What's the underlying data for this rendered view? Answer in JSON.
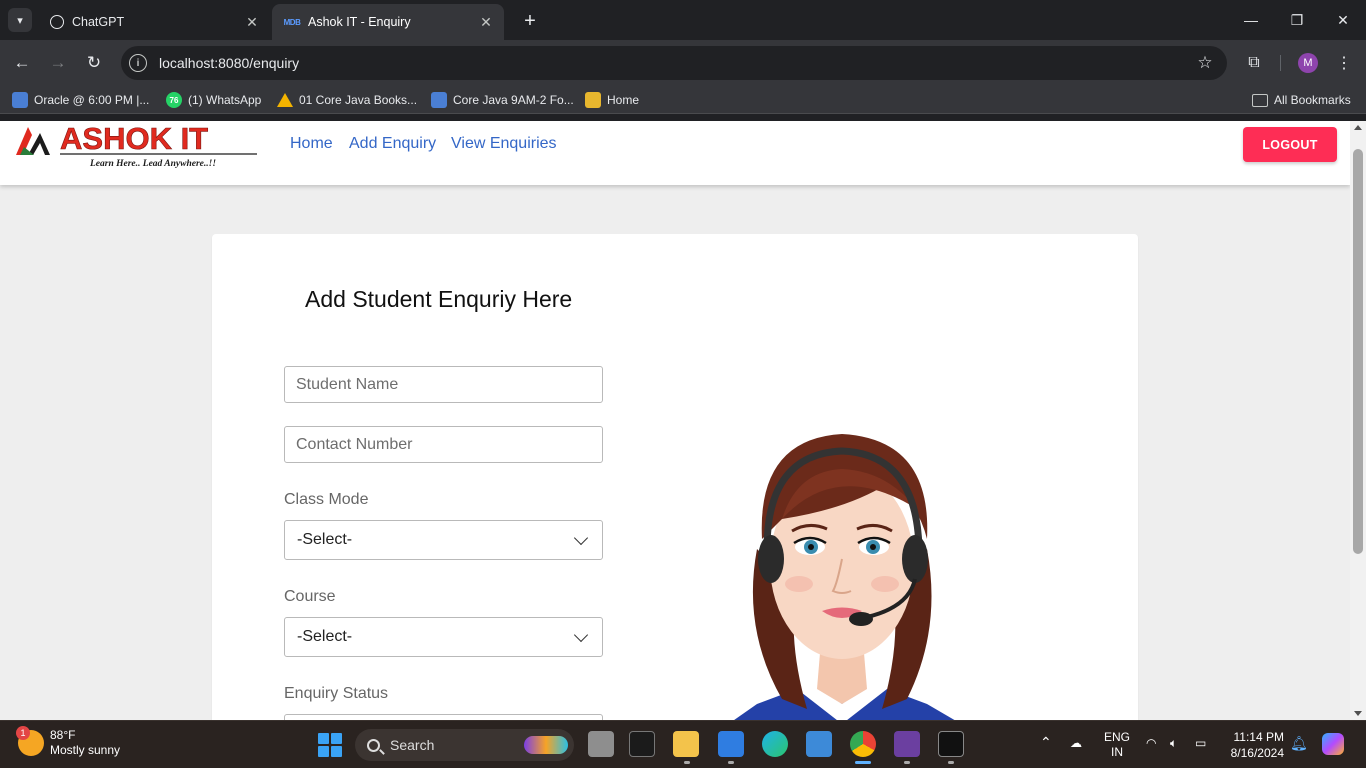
{
  "browser": {
    "tabs": [
      {
        "title": "ChatGPT",
        "active": false
      },
      {
        "title": "Ashok IT - Enquiry",
        "active": true
      }
    ],
    "url": "localhost:8080/enquiry",
    "profile_initial": "M",
    "bookmarks": [
      {
        "label": "Oracle @ 6:00 PM |..."
      },
      {
        "label": "(1) WhatsApp",
        "icon_text": "76"
      },
      {
        "label": "01 Core Java Books..."
      },
      {
        "label": "Core Java 9AM-2 Fo..."
      },
      {
        "label": "Home"
      }
    ],
    "all_bookmarks": "All Bookmarks"
  },
  "navbar": {
    "logo_text": "ASHOK IT",
    "logo_tagline": "Learn Here.. Lead Anywhere..!!",
    "links": [
      "Home",
      "Add Enquiry",
      "View Enquiries"
    ],
    "logout_label": "LOGOUT"
  },
  "form": {
    "title": "Add Student Enquriy Here",
    "student_name_placeholder": "Student Name",
    "contact_placeholder": "Contact Number",
    "class_mode_label": "Class Mode",
    "class_mode_value": "-Select-",
    "course_label": "Course",
    "course_value": "-Select-",
    "status_label": "Enquiry Status"
  },
  "taskbar": {
    "weather_temp": "88°F",
    "weather_desc": "Mostly sunny",
    "weather_badge": "1",
    "search_label": "Search",
    "lang_line1": "ENG",
    "lang_line2": "IN",
    "time": "11:14 PM",
    "date": "8/16/2024"
  },
  "colors": {
    "accent_logout": "#fe2d55",
    "nav_link": "#3467c7",
    "logo_red": "#e02a1f"
  }
}
